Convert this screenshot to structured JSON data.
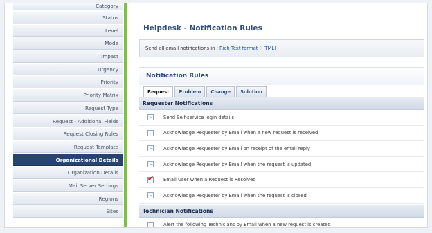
{
  "sidebar": {
    "items": [
      {
        "label": "Category",
        "active": false
      },
      {
        "label": "Status",
        "active": false
      },
      {
        "label": "Level",
        "active": false
      },
      {
        "label": "Mode",
        "active": false
      },
      {
        "label": "Impact",
        "active": false
      },
      {
        "label": "Urgency",
        "active": false
      },
      {
        "label": "Priority",
        "active": false
      },
      {
        "label": "Priority Matrix",
        "active": false
      },
      {
        "label": "Request Type",
        "active": false
      },
      {
        "label": "Request - Additional Fields",
        "active": false
      },
      {
        "label": "Request Closing Rules",
        "active": false
      },
      {
        "label": "Request Template",
        "active": false
      },
      {
        "label": "Organizational Details",
        "active": true
      },
      {
        "label": "Organization Details",
        "active": false
      },
      {
        "label": "Mail Server Settings",
        "active": false
      },
      {
        "label": "Regions",
        "active": false
      },
      {
        "label": "Sites",
        "active": false
      }
    ]
  },
  "main": {
    "title": "Helpdesk - Notification Rules",
    "format_text": "Send all email notifications in : ",
    "format_link": "Rich Text format (HTML)",
    "section_title": "Notification Rules",
    "tabs": [
      {
        "label": "Request",
        "active": true
      },
      {
        "label": "Problem",
        "active": false
      },
      {
        "label": "Change",
        "active": false
      },
      {
        "label": "Solution",
        "active": false
      }
    ],
    "requester_group": "Requester Notifications",
    "requester_rules": [
      {
        "label": "Send Self-service login details",
        "checked": false
      },
      {
        "label": "Acknowledge Requester by Email when a new request is received",
        "checked": false
      },
      {
        "label": "Acknowledge Requester by Email on receipt of the email reply",
        "checked": false
      },
      {
        "label": "Acknowledge Requester by Email when the request is updated",
        "checked": false
      },
      {
        "label": "Email User when a Request is Resolved",
        "checked": true
      },
      {
        "label": "Acknowledge Requester by Email when the request is closed",
        "checked": false
      }
    ],
    "technician_group": "Technician Notifications",
    "technician_rules": [
      {
        "label": "Alert the following Technicians by Email when a new request is created",
        "checked": false
      }
    ]
  }
}
